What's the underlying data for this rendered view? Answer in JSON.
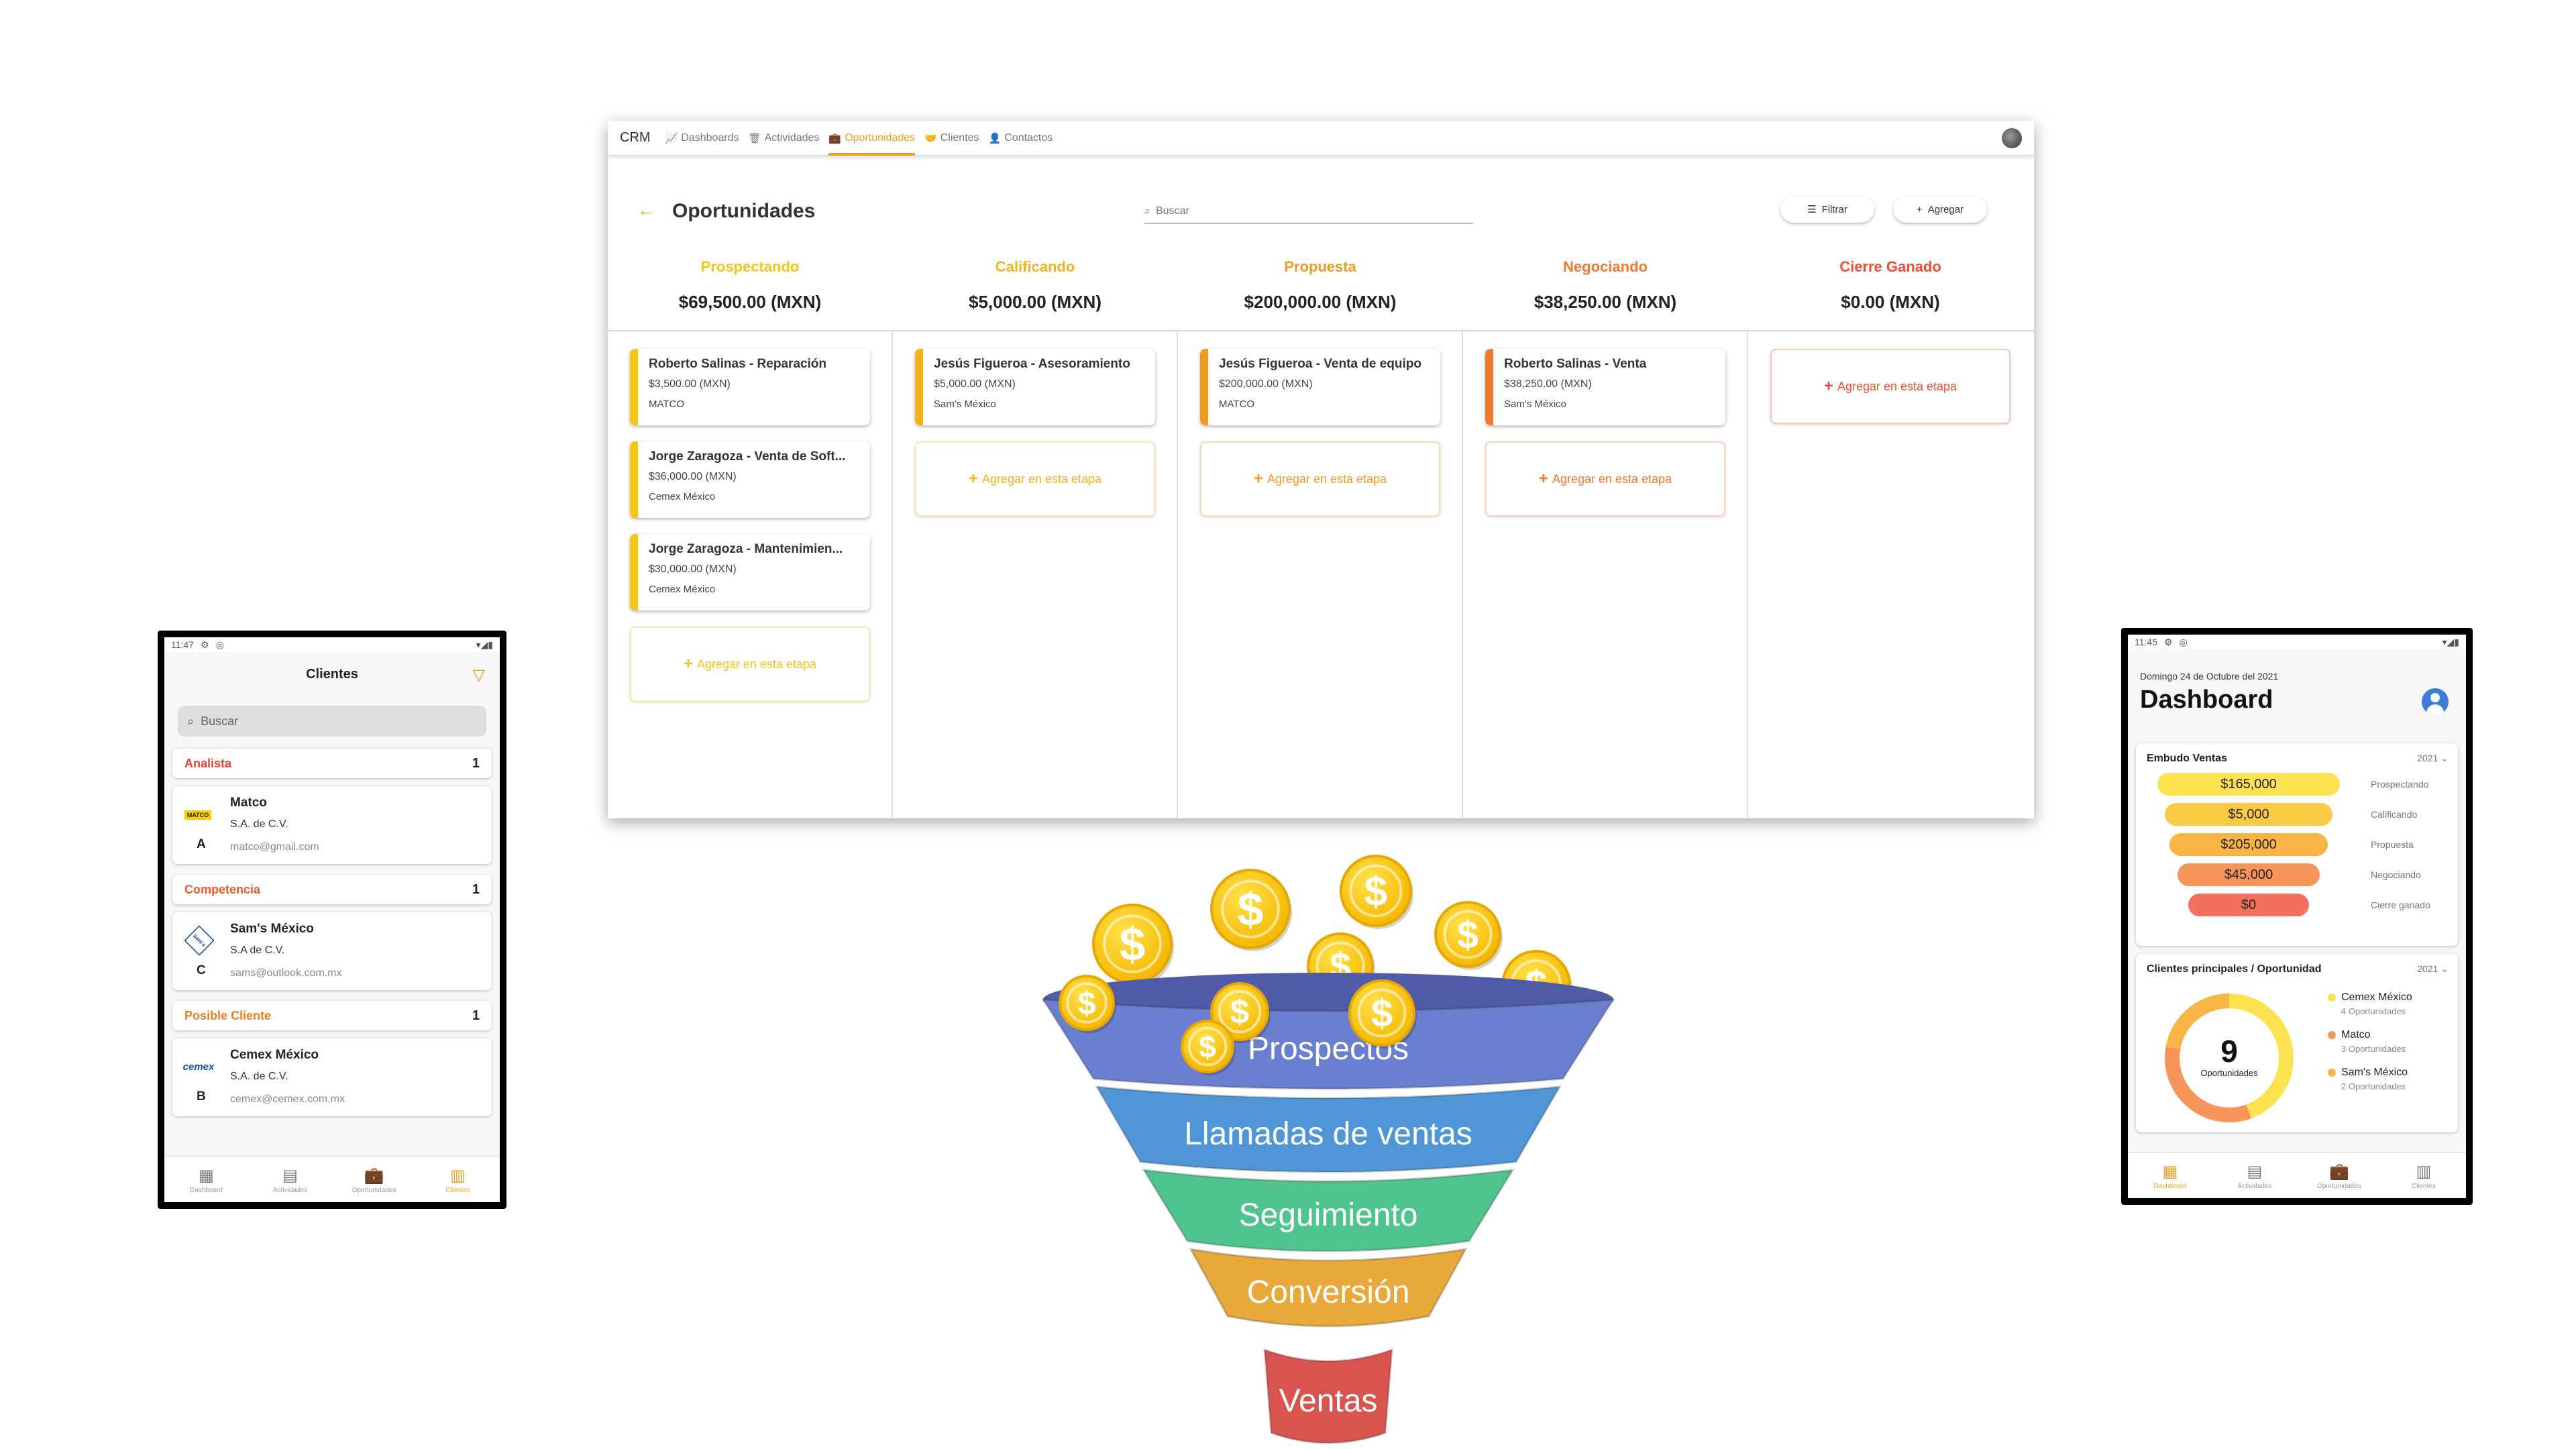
{
  "desktop": {
    "brand": "CRM",
    "nav": [
      {
        "icon": "📈",
        "label": "Dashboards",
        "active": false
      },
      {
        "icon": "🗑",
        "label": "Actividades",
        "active": false
      },
      {
        "icon": "💼",
        "label": "Oportunidades",
        "active": true
      },
      {
        "icon": "🤝",
        "label": "Clientes",
        "active": false
      },
      {
        "icon": "👤",
        "label": "Contactos",
        "active": false
      }
    ],
    "page_title": "Oportunidades",
    "search_placeholder": "Buscar",
    "filter_label": "Filtrar",
    "add_label": "Agregar",
    "add_stage_label": "Agregar en esta etapa",
    "columns": [
      {
        "stage": "Prospectando",
        "color": "#f5c518",
        "amount": "$69,500.00 (MXN)",
        "cards": [
          {
            "title": "Roberto Salinas - Reparación",
            "amount": "$3,500.00 (MXN)",
            "client": "MATCO"
          },
          {
            "title": "Jorge Zaragoza - Venta de Soft...",
            "amount": "$36,000.00 (MXN)",
            "client": "Cemex México"
          },
          {
            "title": "Jorge Zaragoza - Mantenimien...",
            "amount": "$30,000.00 (MXN)",
            "client": "Cemex México"
          }
        ]
      },
      {
        "stage": "Calificando",
        "color": "#f2b21b",
        "amount": "$5,000.00 (MXN)",
        "cards": [
          {
            "title": "Jesús Figueroa - Asesoramiento",
            "amount": "$5,000.00 (MXN)",
            "client": "Sam's México"
          }
        ]
      },
      {
        "stage": "Propuesta",
        "color": "#f29a1e",
        "amount": "$200,000.00 (MXN)",
        "cards": [
          {
            "title": "Jesús Figueroa - Venta de equipo",
            "amount": "$200,000.00 (MXN)",
            "client": "MATCO"
          }
        ]
      },
      {
        "stage": "Negociando",
        "color": "#f07a2e",
        "amount": "$38,250.00 (MXN)",
        "cards": [
          {
            "title": "Roberto Salinas - Venta",
            "amount": "$38,250.00 (MXN)",
            "client": "Sam's México"
          }
        ]
      },
      {
        "stage": "Cierre Ganado",
        "color": "#ee4e30",
        "amount": "$0.00 (MXN)",
        "cards": []
      }
    ]
  },
  "phone_clients": {
    "time": "11:47",
    "title": "Clientes",
    "search_placeholder": "Buscar",
    "groups": [
      {
        "label": "Analista",
        "color": "#ee4030",
        "count": "1",
        "client": {
          "name": "Matco",
          "subtitle": "S.A. de C.V.",
          "email": "matco@gmail.com",
          "letter": "A",
          "logo": "MATCO"
        }
      },
      {
        "label": "Competencia",
        "color": "#ee5a28",
        "count": "1",
        "client": {
          "name": "Sam's México",
          "subtitle": "S.A de C.V.",
          "email": "sams@outlook.com.mx",
          "letter": "C",
          "logo": "Sam's"
        }
      },
      {
        "label": "Posible Cliente",
        "color": "#f07a20",
        "count": "1",
        "client": {
          "name": "Cemex México",
          "subtitle": "S.A. de C.V.",
          "email": "cemex@cemex.com.mx",
          "letter": "B",
          "logo": "cemex"
        }
      }
    ],
    "tabs": [
      {
        "icon": "▦",
        "label": "Dashboard",
        "active": false
      },
      {
        "icon": "▤",
        "label": "Actividades",
        "active": false
      },
      {
        "icon": "💼",
        "label": "Oportunidades",
        "active": false
      },
      {
        "icon": "▥",
        "label": "Clientes",
        "active": true
      }
    ]
  },
  "phone_dashboard": {
    "time": "11:45",
    "date": "Domingo 24 de Octubre del 2021",
    "title": "Dashboard",
    "funnel_card": {
      "title": "Embudo Ventas",
      "year": "2021",
      "rows": [
        {
          "value": "$165,000",
          "label": "Prospectando",
          "color": "#fde24f"
        },
        {
          "value": "$5,000",
          "label": "Calificando",
          "color": "#fccb45"
        },
        {
          "value": "$205,000",
          "label": "Propuesta",
          "color": "#f9b446"
        },
        {
          "value": "$45,000",
          "label": "Negociando",
          "color": "#f6945a"
        },
        {
          "value": "$0",
          "label": "Cierre ganado",
          "color": "#f4705e"
        }
      ]
    },
    "clients_card": {
      "title": "Clientes principales / Oportunidad",
      "year": "2021",
      "total": "9",
      "total_label": "Oportunidades",
      "legend": [
        {
          "name": "Cemex México",
          "sub": "4 Oportunidades",
          "value": 4,
          "color": "#fde24f"
        },
        {
          "name": "Matco",
          "sub": "3 Oportunidades",
          "value": 3,
          "color": "#f6945a"
        },
        {
          "name": "Sam's México",
          "sub": "2 Oportunidades",
          "value": 2,
          "color": "#f9b446"
        }
      ]
    },
    "tabs": [
      {
        "icon": "▦",
        "label": "Dashboard",
        "active": true
      },
      {
        "icon": "▤",
        "label": "Actividades",
        "active": false
      },
      {
        "icon": "💼",
        "label": "Oportunidades",
        "active": false
      },
      {
        "icon": "▥",
        "label": "Clientes",
        "active": false
      }
    ]
  },
  "funnel_graphic": {
    "coin_symbol": "$",
    "stages": [
      {
        "label": "Prospectos",
        "color": "#6a7fd0"
      },
      {
        "label": "Llamadas de ventas",
        "color": "#4f96d6"
      },
      {
        "label": "Seguimiento",
        "color": "#4fc48e"
      },
      {
        "label": "Conversión",
        "color": "#e9a93a"
      },
      {
        "label": "Ventas",
        "color": "#d9534f"
      }
    ]
  }
}
